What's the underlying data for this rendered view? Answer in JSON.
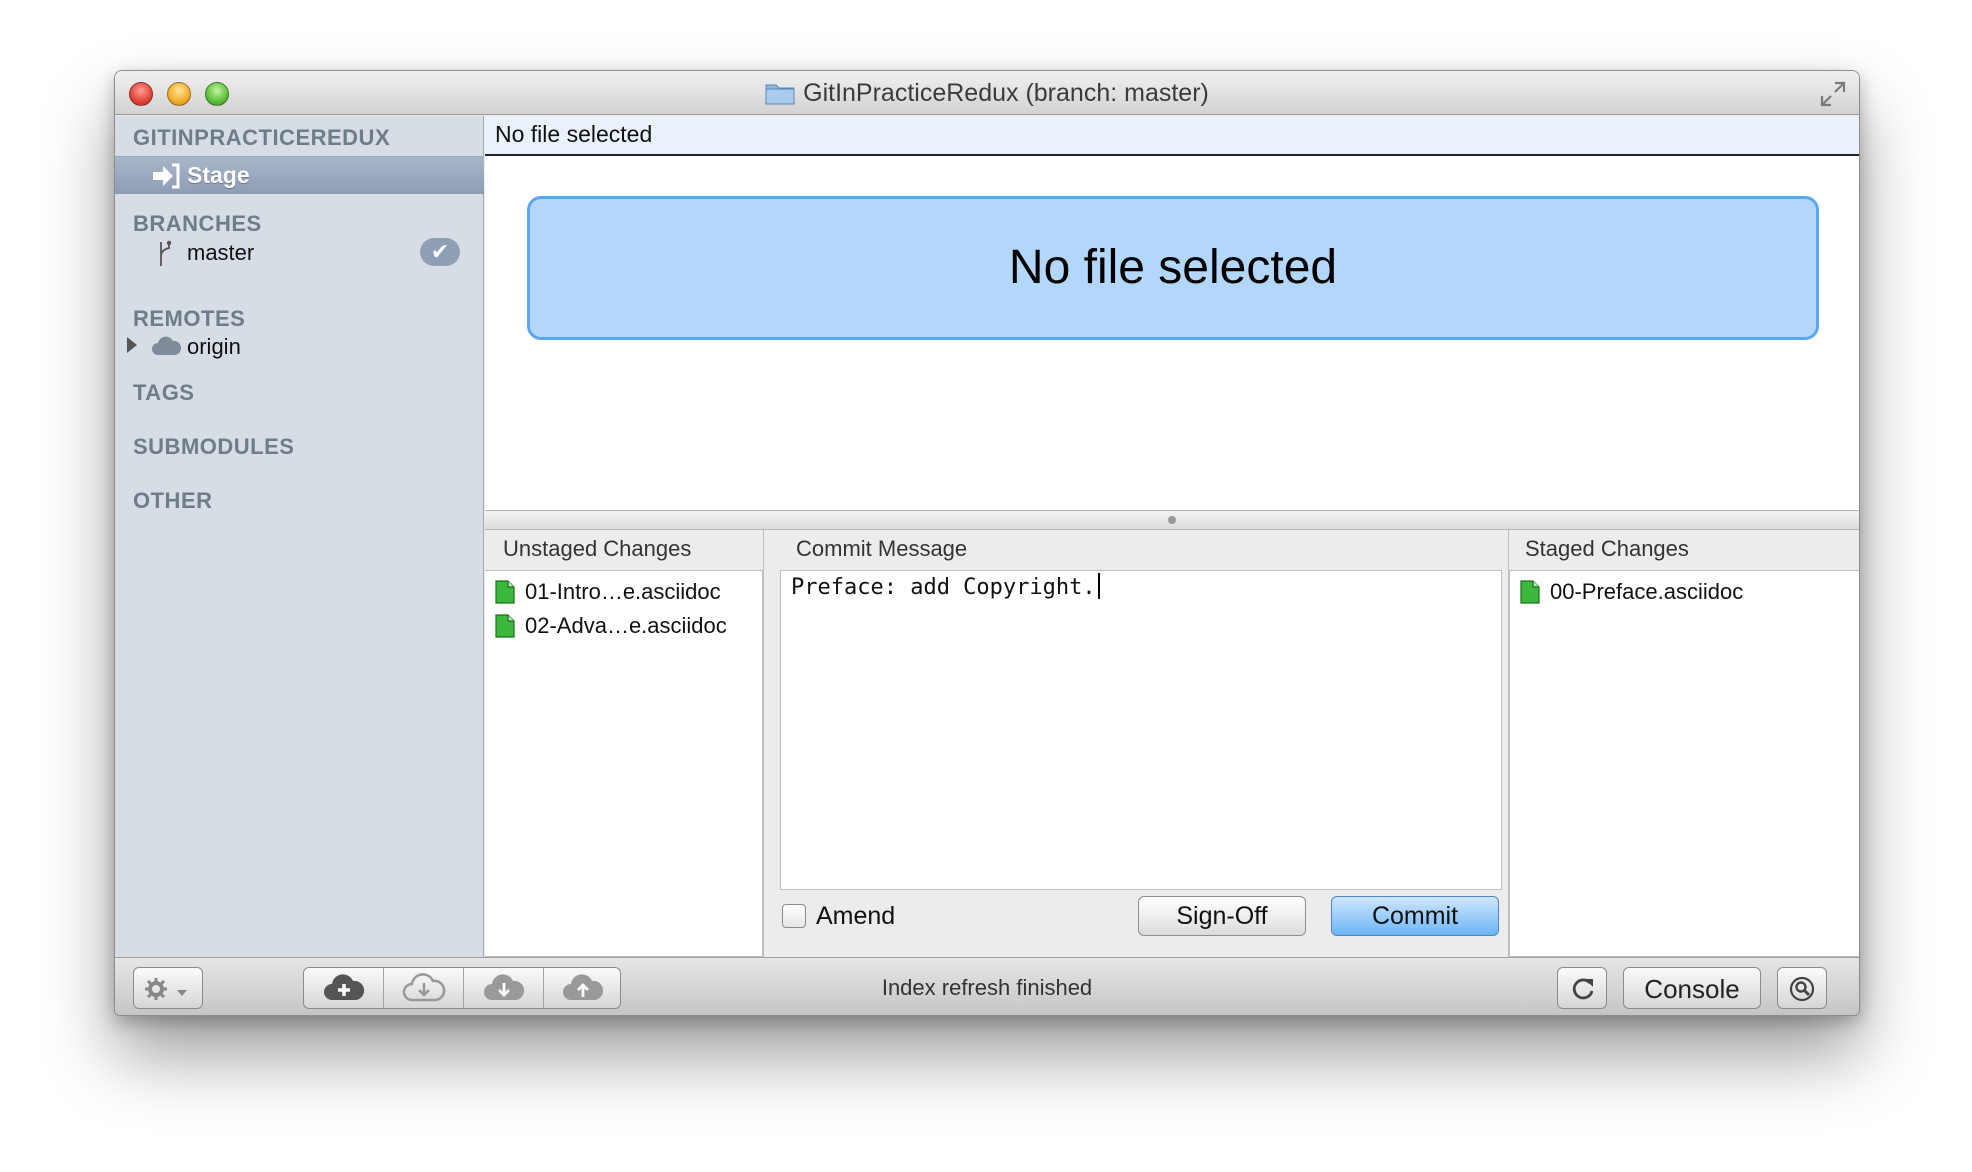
{
  "window": {
    "title": "GitInPracticeRedux (branch: master)"
  },
  "sidebar": {
    "repo_heading": "GITINPRACTICEREDUX",
    "stage_label": "Stage",
    "branches_heading": "BRANCHES",
    "branch_item": "master",
    "branch_check": "✔",
    "remotes_heading": "REMOTES",
    "remote_item": "origin",
    "tags_heading": "TAGS",
    "submodules_heading": "SUBMODULES",
    "other_heading": "OTHER"
  },
  "diff": {
    "header": "No file selected",
    "placeholder": "No file selected"
  },
  "unstaged": {
    "title": "Unstaged Changes",
    "files": [
      "01-Intro…e.asciidoc",
      "02-Adva…e.asciidoc"
    ]
  },
  "commit": {
    "title": "Commit Message",
    "message": "Preface: add Copyright.",
    "amend_label": "Amend",
    "amend_checked": false,
    "signoff_label": "Sign-Off",
    "commit_label": "Commit"
  },
  "staged": {
    "title": "Staged Changes",
    "files": [
      "00-Preface.asciidoc"
    ]
  },
  "toolbar": {
    "status": "Index refresh finished",
    "console_label": "Console",
    "icons": [
      "gear-icon",
      "cloud-add-icon",
      "cloud-fetch-icon",
      "cloud-pull-icon",
      "cloud-push-icon",
      "refresh-icon",
      "search-icon"
    ]
  },
  "colors": {
    "sidebar_bg": "#d6dde5",
    "selection": "#8d9db4",
    "placeholder_bg": "#b3d7fa",
    "placeholder_border": "#5aa6f1",
    "file_icon": "#3cb83c",
    "commit_button": "#6db6f5"
  }
}
